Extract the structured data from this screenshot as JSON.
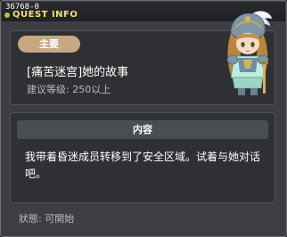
{
  "window": {
    "id_text": "36768-0",
    "title": "QUEST INFO"
  },
  "quest": {
    "category": "主要",
    "name": "[痛苦迷宫]她的故事",
    "level_requirement": "建议等级: 250以上"
  },
  "content": {
    "header": "内容",
    "body": "我带着昏迷成员转移到了安全区域。试着与她对话吧。"
  },
  "status": {
    "text": "狀態:  可開始"
  },
  "colors": {
    "title": "#f2e16b",
    "badge": "#c6a983",
    "panel": "#2e3033",
    "window": "#3c3e43"
  },
  "icons": {
    "title_icon": "quest-dot-icon",
    "npc": "npc-portrait"
  }
}
